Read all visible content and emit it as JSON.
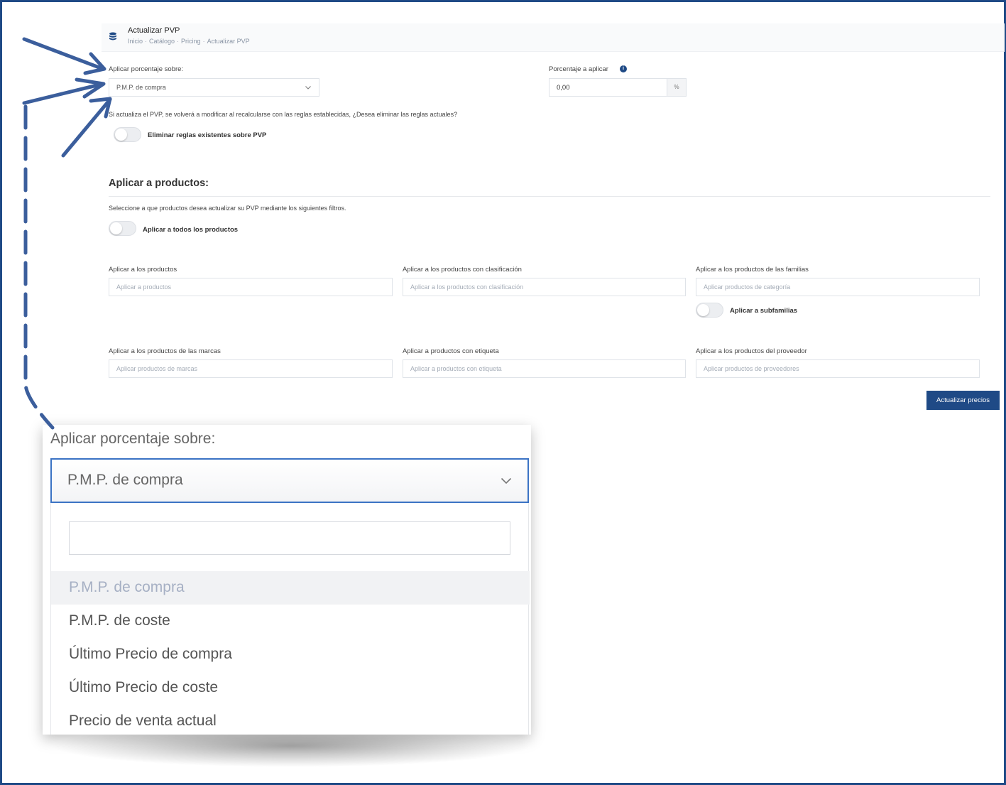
{
  "header": {
    "title": "Actualizar PVP",
    "breadcrumb": [
      "Inicio",
      "Catálogo",
      "Pricing",
      "Actualizar PVP"
    ]
  },
  "form": {
    "apply_on_label": "Aplicar porcentaje sobre:",
    "apply_on_value": "P.M.P. de compra",
    "percentage_label": "Porcentaje a aplicar",
    "percentage_value": "0,00",
    "percentage_unit": "%",
    "warning_text": "Si actualiza el PVP, se volverá a modificar al recalcularse con las reglas establecidas, ¿Desea eliminar las reglas actuales?",
    "remove_rules_label": "Eliminar reglas existentes sobre PVP"
  },
  "products": {
    "section_title": "Aplicar a productos:",
    "description": "Seleccione a que productos desea actualizar su PVP mediante los siguientes filtros.",
    "apply_all_label": "Aplicar a todos los productos",
    "fields": [
      {
        "label": "Aplicar a los productos",
        "placeholder": "Aplicar a productos"
      },
      {
        "label": "Aplicar a los productos con clasificación",
        "placeholder": "Aplicar a los productos con clasificación"
      },
      {
        "label": "Aplicar a los productos de las familias",
        "placeholder": "Aplicar productos de categoría"
      },
      {
        "label": "Aplicar a los productos de las marcas",
        "placeholder": "Aplicar productos de marcas"
      },
      {
        "label": "Aplicar a productos con etiqueta",
        "placeholder": "Aplicar a productos con etiqueta"
      },
      {
        "label": "Aplicar a los productos del proveedor",
        "placeholder": "Aplicar productos de proveedores"
      }
    ],
    "subfamilies_label": "Aplicar a subfamilias",
    "update_button": "Actualizar precios"
  },
  "zoom": {
    "label": "Aplicar porcentaje sobre:",
    "selected_value": "P.M.P. de compra",
    "search_value": "",
    "options": [
      "P.M.P. de compra",
      "P.M.P. de coste",
      "Último Precio de compra",
      "Último Precio de coste",
      "Precio de venta actual"
    ]
  },
  "colors": {
    "accent": "#1f4a86",
    "focus_border": "#3b73c4",
    "annotation_arrow": "#3b5e9c"
  }
}
